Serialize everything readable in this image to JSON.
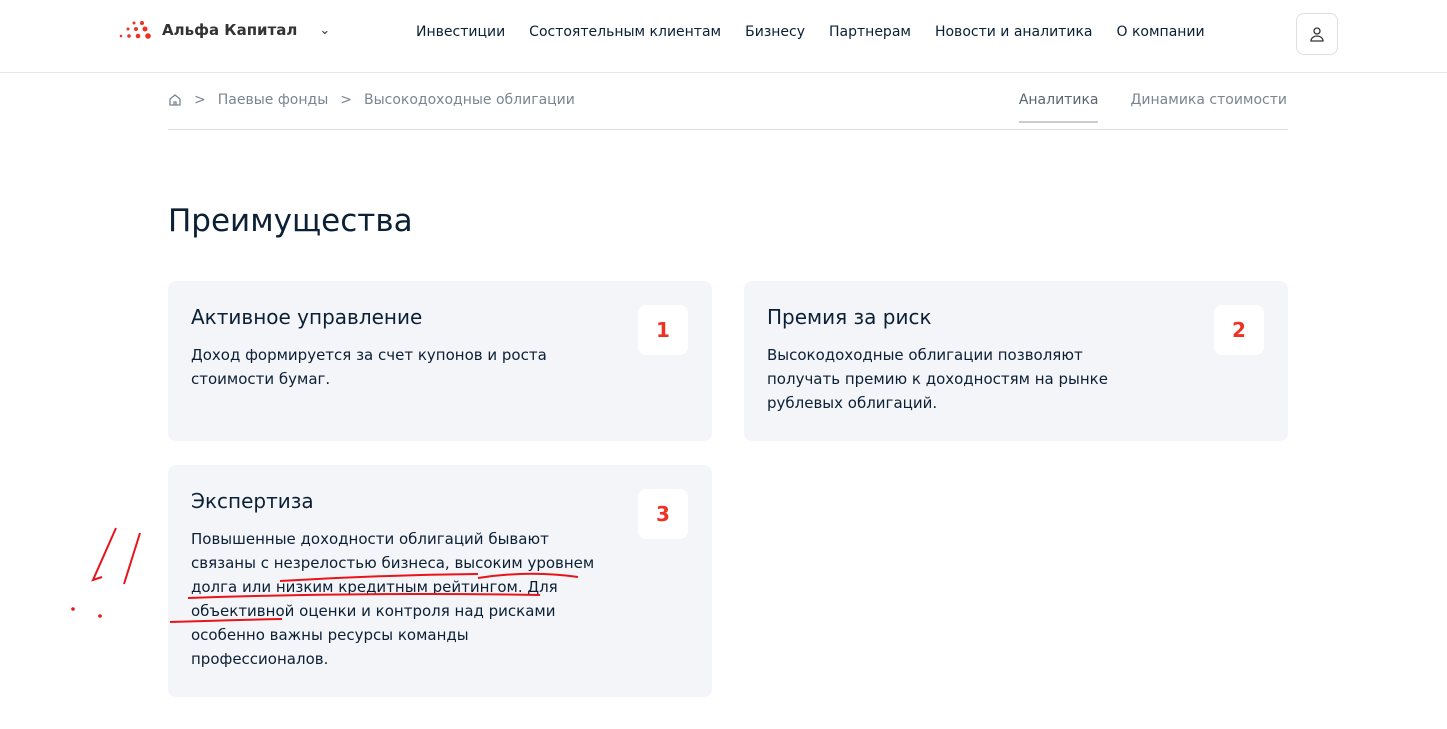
{
  "header": {
    "logo_text": "Альфа Капитал",
    "nav": [
      "Инвестиции",
      "Состоятельным клиентам",
      "Бизнесу",
      "Партнерам",
      "Новости и аналитика",
      "О компании"
    ]
  },
  "breadcrumb": {
    "items": [
      "Паевые фонды",
      "Высокодоходные облигации"
    ],
    "separator": ">"
  },
  "tabs": [
    "Аналитика",
    "Динамика стоимости"
  ],
  "page_title": "Преимущества",
  "cards": [
    {
      "number": "1",
      "title": "Активное управление",
      "text": "Доход формируется за счет купонов и роста стоимости бумаг."
    },
    {
      "number": "2",
      "title": "Премия за риск",
      "text": "Высокодоходные облигации позволяют получать премию к доходностям на рынке рублевых облигаций."
    },
    {
      "number": "3",
      "title": "Экспертиза",
      "text": "Повышенные доходности облигаций бывают связаны с незрелостью бизнеса, высоким уровнем долга или низким кредитным рейтингом. Для объективной оценки и контроля над рисками особенно важны ресурсы команды профессионалов."
    }
  ],
  "colors": {
    "accent": "#ef3124",
    "card_bg": "#f4f5f9"
  }
}
